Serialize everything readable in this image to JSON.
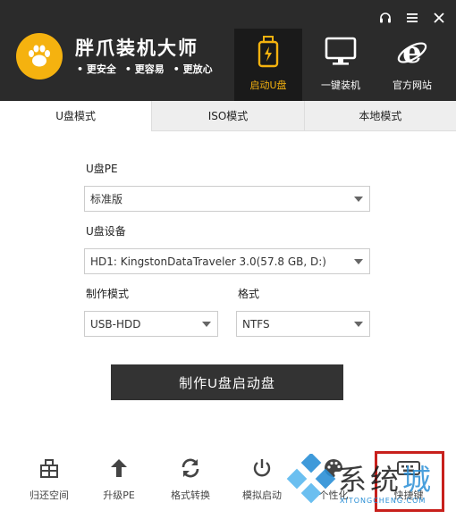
{
  "header": {
    "app_title": "胖爪装机大师",
    "slogans": [
      "更安全",
      "更容易",
      "更放心"
    ],
    "nav": [
      {
        "label": "启动U盘",
        "icon": "usb-lightning-icon",
        "active": true
      },
      {
        "label": "一键装机",
        "icon": "monitor-icon",
        "active": false
      },
      {
        "label": "官方网站",
        "icon": "ie-browser-icon",
        "active": false
      }
    ],
    "window_controls": [
      "headset-icon",
      "menu-icon",
      "close-icon"
    ],
    "logo_icon": "paw-icon"
  },
  "tabs": [
    {
      "label": "U盘模式",
      "active": true
    },
    {
      "label": "ISO模式",
      "active": false
    },
    {
      "label": "本地模式",
      "active": false
    }
  ],
  "form": {
    "pe_label": "U盘PE",
    "pe_value": "标准版",
    "device_label": "U盘设备",
    "device_value": "HD1: KingstonDataTraveler 3.0(57.8 GB, D:)",
    "mode_label": "制作模式",
    "mode_value": "USB-HDD",
    "format_label": "格式",
    "format_value": "NTFS",
    "make_button": "制作U盘启动盘"
  },
  "toolbar": [
    {
      "label": "归还空间",
      "icon": "restore-space-icon"
    },
    {
      "label": "升级PE",
      "icon": "arrow-up-icon"
    },
    {
      "label": "格式转换",
      "icon": "convert-icon"
    },
    {
      "label": "模拟启动",
      "icon": "power-icon"
    },
    {
      "label": "个性化",
      "icon": "palette-icon"
    },
    {
      "label": "快捷键",
      "icon": "keyboard-icon"
    }
  ],
  "watermark": {
    "text_main": "系统",
    "text_accent": "城",
    "url": "XITONGCHENG.COM"
  },
  "colors": {
    "header_bg": "#2b2b2b",
    "accent": "#f5b20f",
    "button_bg": "#333333",
    "highlight_box": "#c8201c"
  }
}
